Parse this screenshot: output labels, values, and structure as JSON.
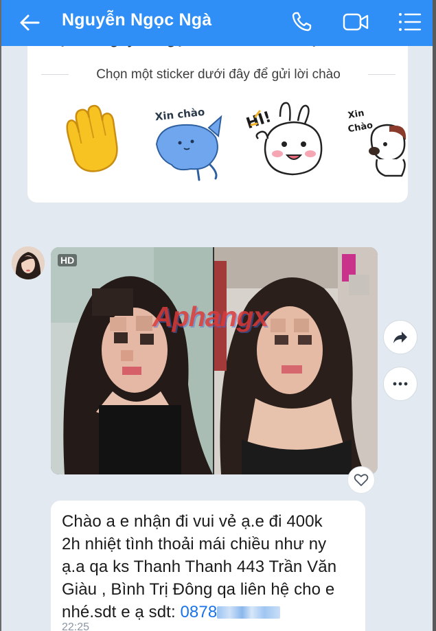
{
  "header": {
    "title": "Nguyễn Ngọc Ngà",
    "icons": [
      "back-arrow-icon",
      "phone-icon",
      "video-call-icon",
      "menu-icon"
    ],
    "background": "#2f8ff6"
  },
  "sticker_card": {
    "cut_text": "Bạn và Nguyễn Ngọc ...  đã trở thành bạn bè",
    "hint": "Chọn một sticker dưới đây để gửi lời chào",
    "stickers": [
      {
        "name": "waving-hand-sticker"
      },
      {
        "name": "xin-chao-blue-cat-sticker",
        "caption": "Xin chào"
      },
      {
        "name": "hi-bunny-sticker",
        "caption": "HI!"
      },
      {
        "name": "xin-chao-dog-sticker",
        "caption": "Xin Chào"
      }
    ]
  },
  "photo_message": {
    "badge": "HD",
    "watermark": "Aphangx"
  },
  "text_message": {
    "lines": [
      "Chào a e nhận đi vui vẻ ạ.e đi 400k",
      "2h nhiệt tình thoải mái chiều như ny",
      "ạ.a qa ks Thanh Thanh 443 Trần Văn",
      "Giàu , Bình Trị Đông qa liên hệ cho e"
    ],
    "last_line_prefix": "nhé.sdt e ạ sdt: ",
    "phone_visible": "0878",
    "time": "22:25"
  }
}
